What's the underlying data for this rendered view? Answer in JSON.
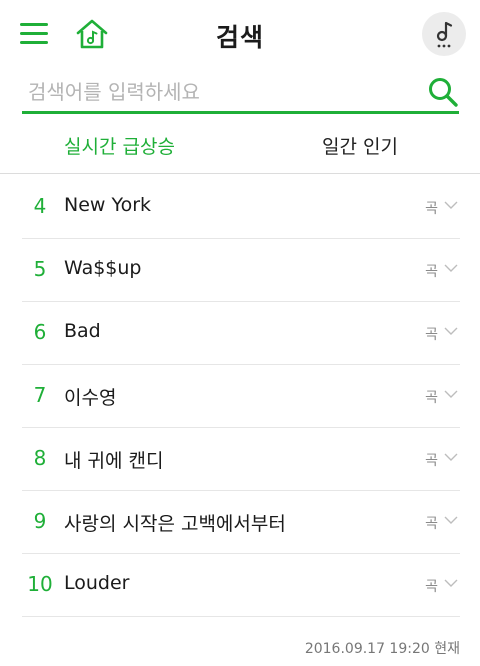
{
  "header": {
    "title": "검색",
    "icons": {
      "menu": "menu-icon",
      "home": "home-music-icon",
      "player": "music-note-icon"
    }
  },
  "search": {
    "placeholder": "검색어를 입력하세요",
    "value": ""
  },
  "tabs": [
    {
      "label": "실시간 급상승",
      "active": true
    },
    {
      "label": "일간 인기",
      "active": false
    }
  ],
  "rows": [
    {
      "rank": "4",
      "title": "New York",
      "type": "곡"
    },
    {
      "rank": "5",
      "title": "Wa$$up",
      "type": "곡"
    },
    {
      "rank": "6",
      "title": "Bad",
      "type": "곡"
    },
    {
      "rank": "7",
      "title": "이수영",
      "type": "곡"
    },
    {
      "rank": "8",
      "title": "내 귀에 캔디",
      "type": "곡"
    },
    {
      "rank": "9",
      "title": "사랑의 시작은 고백에서부터",
      "type": "곡"
    },
    {
      "rank": "10",
      "title": "Louder",
      "type": "곡"
    }
  ],
  "timestamp": "2016.09.17 19:20 현재",
  "colors": {
    "accent": "#1faf38",
    "divider": "#e6e6e6",
    "muted": "#8a8a8a"
  }
}
